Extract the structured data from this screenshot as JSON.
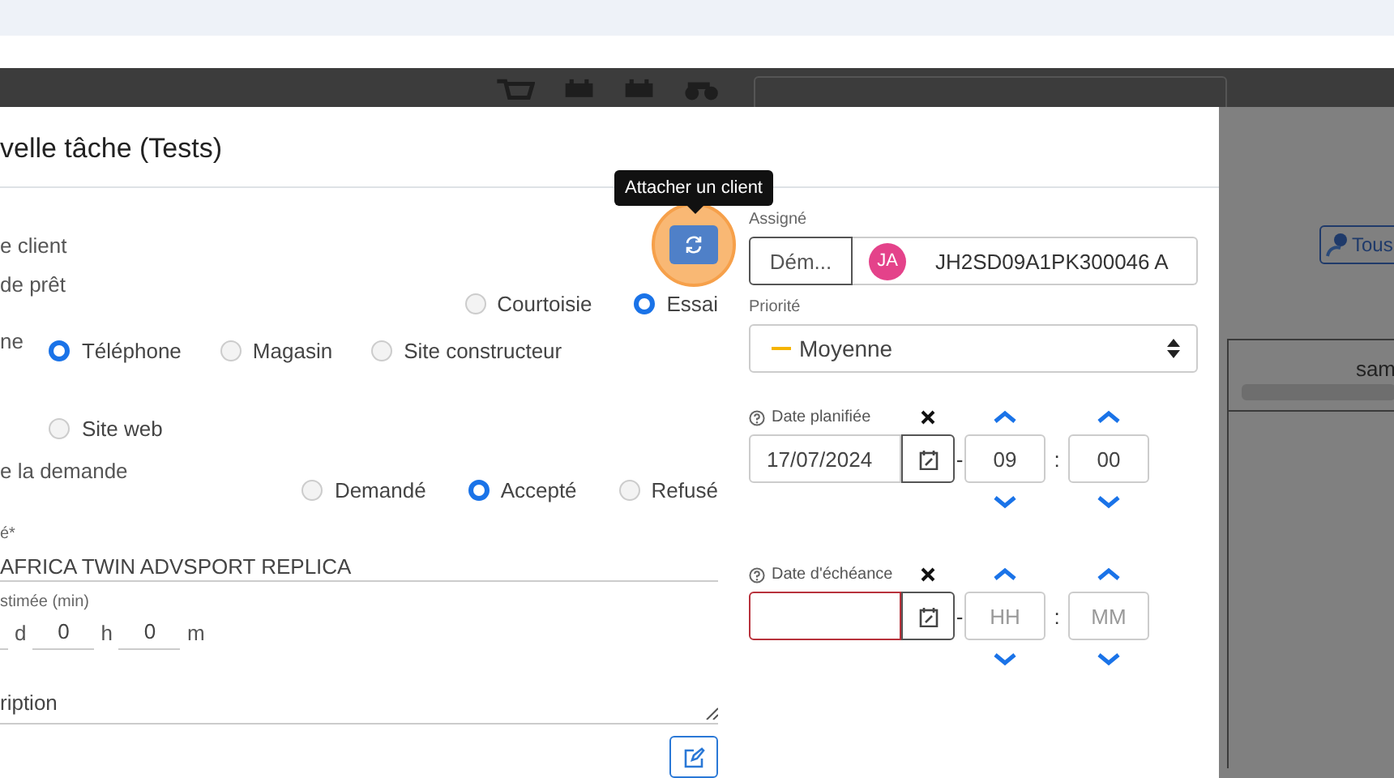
{
  "background": {
    "filter_button": "Tous",
    "column_header": "sam"
  },
  "modal": {
    "title": "velle tâche (Tests)"
  },
  "tooltip": "Attacher un client",
  "client": {
    "label": "e client",
    "focused": true
  },
  "loan_type": {
    "label": "de prêt",
    "options": [
      {
        "label": "Courtoisie",
        "selected": false
      },
      {
        "label": "Essai",
        "selected": true
      }
    ]
  },
  "origin": {
    "label": "ne",
    "options": [
      {
        "label": "Téléphone",
        "selected": true
      },
      {
        "label": "Magasin",
        "selected": false
      },
      {
        "label": "Site constructeur",
        "selected": false
      },
      {
        "label": "Site web",
        "selected": false
      }
    ]
  },
  "request_status": {
    "label": "e la demande",
    "options": [
      {
        "label": "Demandé",
        "selected": false
      },
      {
        "label": "Accepté",
        "selected": true
      },
      {
        "label": "Refusé",
        "selected": false
      }
    ]
  },
  "vehicle": {
    "label": "é*",
    "value": "AFRICA TWIN ADVSPORT REPLICA"
  },
  "duration": {
    "label": "stimée (min)",
    "parts": [
      {
        "unit": "d"
      },
      {
        "value": "0",
        "unit": "h"
      },
      {
        "value": "0",
        "unit": "m"
      }
    ]
  },
  "description": {
    "placeholder": "ription"
  },
  "assigned": {
    "label": "Assigné",
    "type": "Dém...",
    "avatar": "JA",
    "value": "JH2SD09A1PK300046 A"
  },
  "priority": {
    "label": "Priorité",
    "value": "Moyenne"
  },
  "dates": [
    {
      "label": "Date planifiée",
      "value": "17/07/2024",
      "dash": "-",
      "hour": "09",
      "colon": ":",
      "minute": "00",
      "invalid": false
    },
    {
      "label": "Date d'échéance",
      "dash": "-",
      "hour_placeholder": "HH",
      "colon": ":",
      "minute_placeholder": "MM",
      "invalid": true
    }
  ]
}
